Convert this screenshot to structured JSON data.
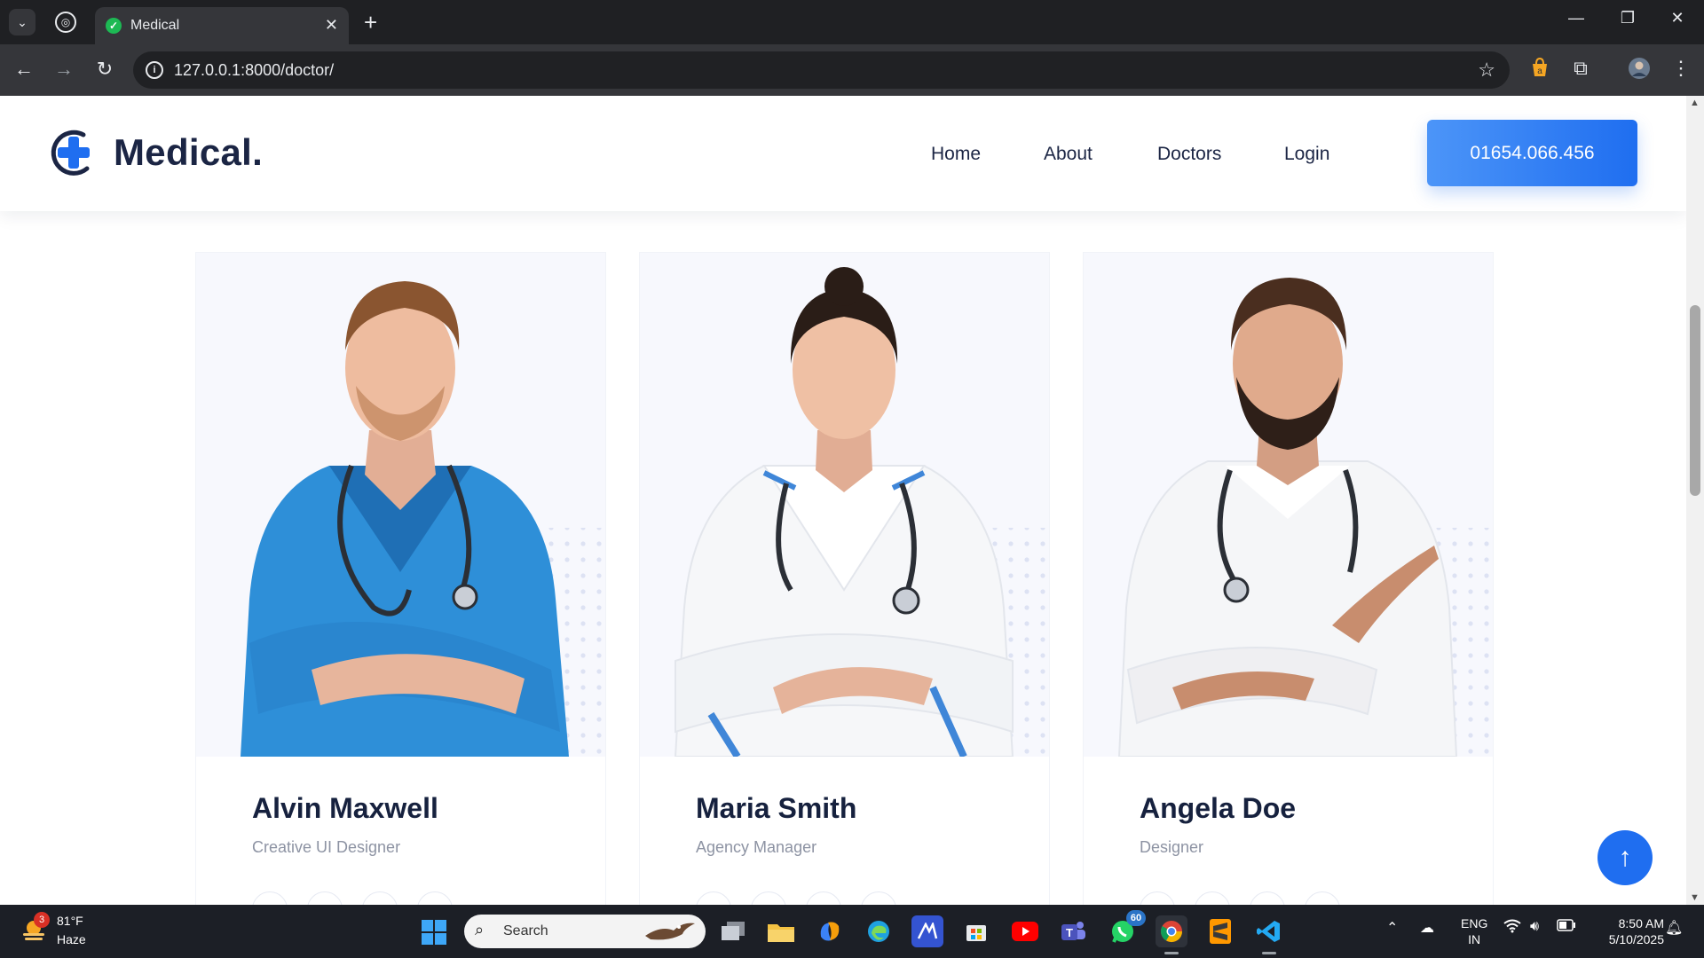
{
  "browser": {
    "tab_title": "Medical",
    "new_tab": "+",
    "url": "127.0.0.1:8000/doctor/",
    "close": "✕",
    "minimize": "—",
    "restore": "❐",
    "window_close": "✕"
  },
  "site": {
    "logo": "Medical.",
    "nav": [
      "Home",
      "About",
      "Doctors",
      "Login"
    ],
    "phone": "01654.066.456",
    "brand_color": "#1f6ef0",
    "text_color": "#1b2544"
  },
  "doctors": [
    {
      "name": "Alvin Maxwell",
      "role": "Creative UI Designer",
      "attire": "blue scrubs"
    },
    {
      "name": "Maria Smith",
      "role": "Agency Manager",
      "attire": "white coat"
    },
    {
      "name": "Angela Doe",
      "role": "Designer",
      "attire": "white coat"
    }
  ],
  "scroll_top_icon": "arrow-up-icon",
  "taskbar": {
    "weather_badge": "3",
    "temperature": "81°F",
    "condition": "Haze",
    "search_label": "Search",
    "whatsapp_badge": "60",
    "lang_line1": "ENG",
    "lang_line2": "IN",
    "time": "8:50 AM",
    "date": "5/10/2025"
  }
}
